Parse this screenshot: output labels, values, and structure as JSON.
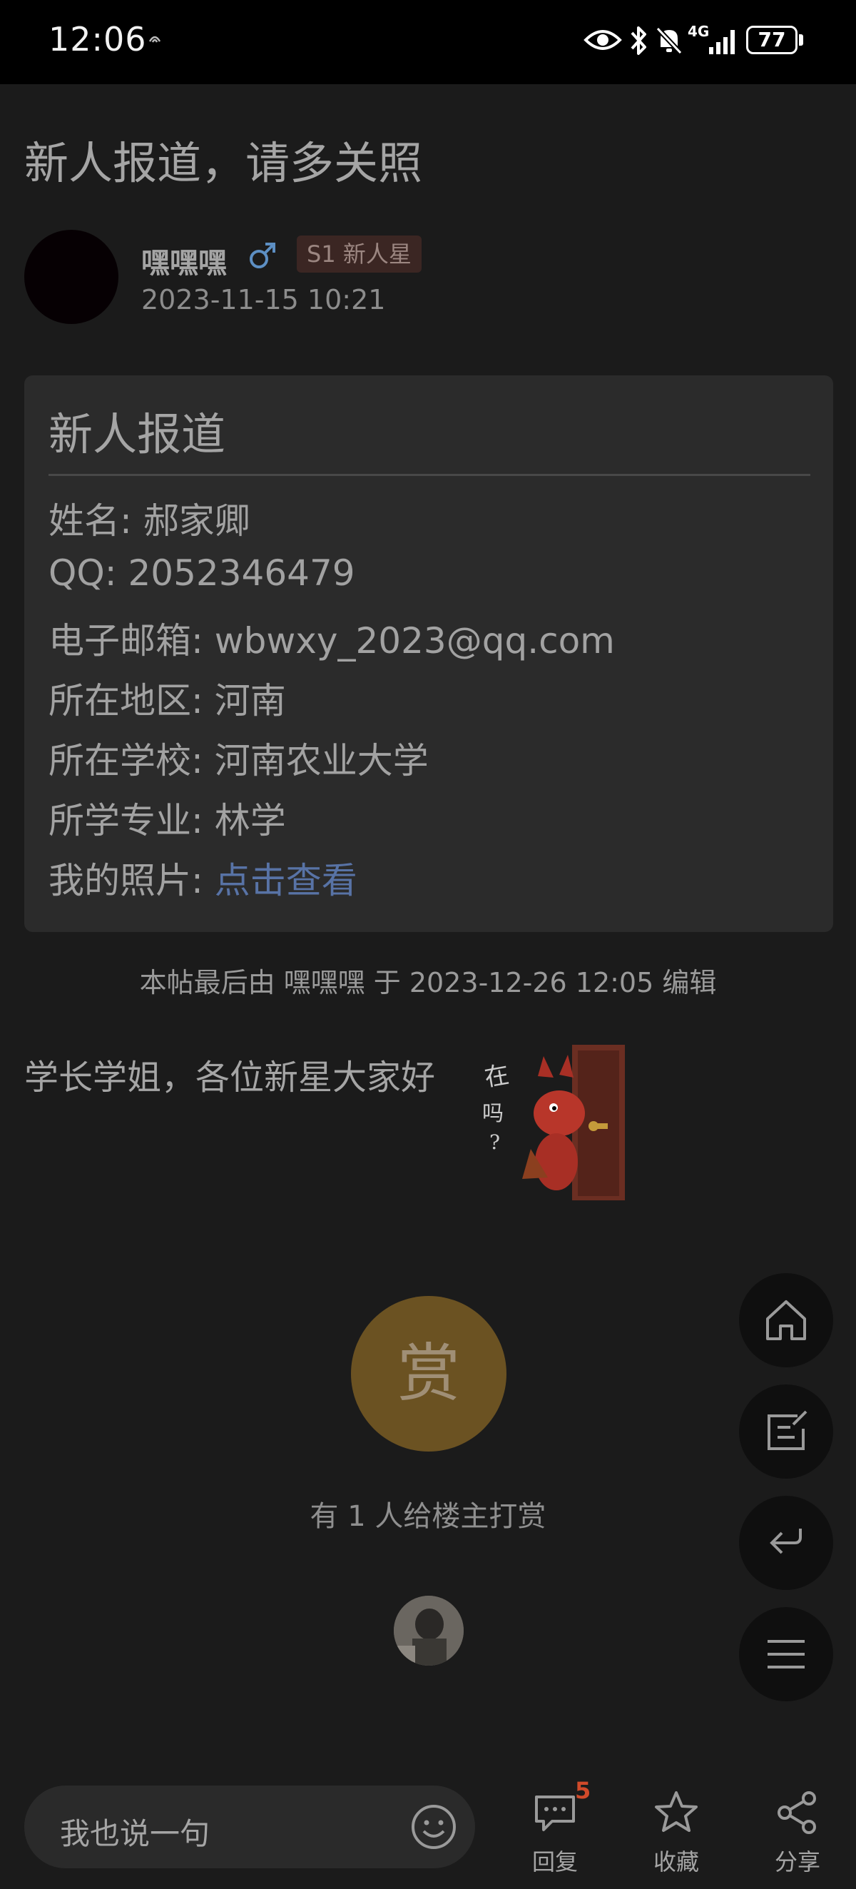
{
  "status_bar": {
    "time": "12:06",
    "network": "4G",
    "battery": "77",
    "icons": [
      "notification-icon",
      "eye-icon",
      "bluetooth-icon",
      "mute-icon",
      "signal-icon",
      "battery-icon"
    ]
  },
  "thread": {
    "title": "新人报道，请多关照",
    "author": {
      "name": "嘿嘿嘿",
      "gender_icon": "male-icon",
      "level_badge": "S1 新人星",
      "post_time": "2023-11-15 10:21"
    }
  },
  "profile_card": {
    "title": "新人报道",
    "rows": [
      {
        "label": "姓名:",
        "value": "郝家卿"
      },
      {
        "label": "QQ:",
        "value": "2052346479"
      },
      {
        "label": "电子邮箱:",
        "value": "wbwxy_2023@qq.com"
      },
      {
        "label": "所在地区:",
        "value": "河南"
      },
      {
        "label": "所在学校:",
        "value": "河南农业大学"
      },
      {
        "label": "所学专业:",
        "value": "林学"
      },
      {
        "label": "我的照片:",
        "value": "点击查看"
      }
    ]
  },
  "edit_note": "本帖最后由 嘿嘿嘿 于 2023-12-26 12:05 编辑",
  "post_body": "学长学姐，各位新星大家好",
  "reward": {
    "button_label": "赏",
    "summary": "有 1 人给楼主打赏"
  },
  "floating_buttons": [
    "home-icon",
    "edit-icon",
    "back-icon",
    "menu-icon"
  ],
  "bottom_bar": {
    "reply_placeholder": "我也说一句",
    "reply_label": "回复",
    "reply_count": "5",
    "favorite_label": "收藏",
    "share_label": "分享"
  },
  "colors": {
    "background": "#1b1b1b",
    "card": "#2b2b2b",
    "link": "#5873a6",
    "reward": "#6b5222",
    "badge_bg": "#3b2623",
    "reply_count": "#d04a2a"
  }
}
